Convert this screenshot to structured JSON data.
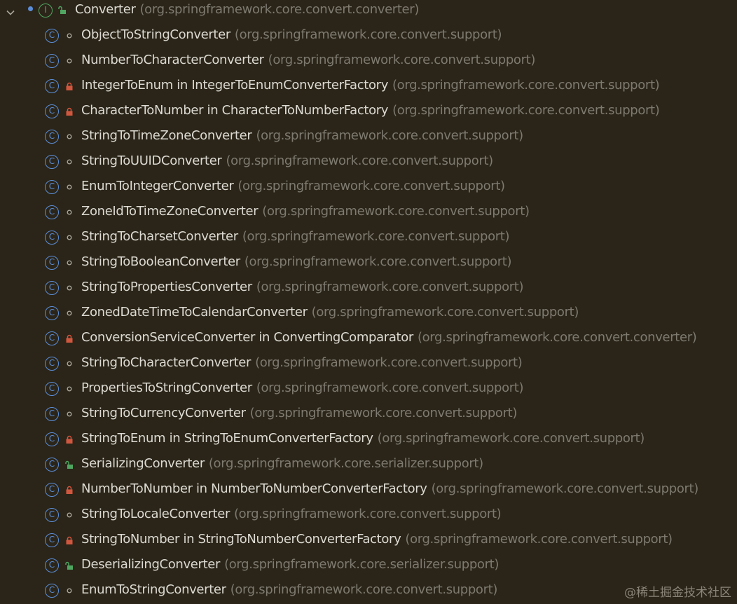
{
  "root": {
    "name": "Converter",
    "package": "(org.springframework.core.convert.converter)",
    "kind_icon": "interface-icon",
    "kind_letter": "I",
    "visibility": "public",
    "expanded": true
  },
  "children": [
    {
      "name": "ObjectToStringConverter",
      "package": "(org.springframework.core.convert.support)",
      "visibility": "package"
    },
    {
      "name": "NumberToCharacterConverter",
      "package": "(org.springframework.core.convert.support)",
      "visibility": "package"
    },
    {
      "name": "IntegerToEnum in IntegerToEnumConverterFactory",
      "package": "(org.springframework.core.convert.support)",
      "visibility": "private"
    },
    {
      "name": "CharacterToNumber in CharacterToNumberFactory",
      "package": "(org.springframework.core.convert.support)",
      "visibility": "private"
    },
    {
      "name": "StringToTimeZoneConverter",
      "package": "(org.springframework.core.convert.support)",
      "visibility": "package"
    },
    {
      "name": "StringToUUIDConverter",
      "package": "(org.springframework.core.convert.support)",
      "visibility": "package"
    },
    {
      "name": "EnumToIntegerConverter",
      "package": "(org.springframework.core.convert.support)",
      "visibility": "package"
    },
    {
      "name": "ZoneIdToTimeZoneConverter",
      "package": "(org.springframework.core.convert.support)",
      "visibility": "package"
    },
    {
      "name": "StringToCharsetConverter",
      "package": "(org.springframework.core.convert.support)",
      "visibility": "package"
    },
    {
      "name": "StringToBooleanConverter",
      "package": "(org.springframework.core.convert.support)",
      "visibility": "package"
    },
    {
      "name": "StringToPropertiesConverter",
      "package": "(org.springframework.core.convert.support)",
      "visibility": "package"
    },
    {
      "name": "ZonedDateTimeToCalendarConverter",
      "package": "(org.springframework.core.convert.support)",
      "visibility": "package"
    },
    {
      "name": "ConversionServiceConverter in ConvertingComparator",
      "package": "(org.springframework.core.convert.converter)",
      "visibility": "private"
    },
    {
      "name": "StringToCharacterConverter",
      "package": "(org.springframework.core.convert.support)",
      "visibility": "package"
    },
    {
      "name": "PropertiesToStringConverter",
      "package": "(org.springframework.core.convert.support)",
      "visibility": "package"
    },
    {
      "name": "StringToCurrencyConverter",
      "package": "(org.springframework.core.convert.support)",
      "visibility": "package"
    },
    {
      "name": "StringToEnum in StringToEnumConverterFactory",
      "package": "(org.springframework.core.convert.support)",
      "visibility": "private"
    },
    {
      "name": "SerializingConverter",
      "package": "(org.springframework.core.serializer.support)",
      "visibility": "public"
    },
    {
      "name": "NumberToNumber in NumberToNumberConverterFactory",
      "package": "(org.springframework.core.convert.support)",
      "visibility": "private"
    },
    {
      "name": "StringToLocaleConverter",
      "package": "(org.springframework.core.convert.support)",
      "visibility": "package"
    },
    {
      "name": "StringToNumber in StringToNumberConverterFactory",
      "package": "(org.springframework.core.convert.support)",
      "visibility": "private"
    },
    {
      "name": "DeserializingConverter",
      "package": "(org.springframework.core.serializer.support)",
      "visibility": "public"
    },
    {
      "name": "EnumToStringConverter",
      "package": "(org.springframework.core.convert.support)",
      "visibility": "package"
    }
  ],
  "class_letter": "C",
  "watermark": "@稀土掘金技术社区",
  "colors": {
    "background": "#2b2519",
    "name_text": "#dcdad2",
    "package_text": "#7e7a70",
    "class_icon": "#5b8ed9",
    "interface_icon": "#50a661",
    "lock_private": "#d0573f",
    "lock_public": "#50a661",
    "package_ring": "#a9a59a"
  }
}
